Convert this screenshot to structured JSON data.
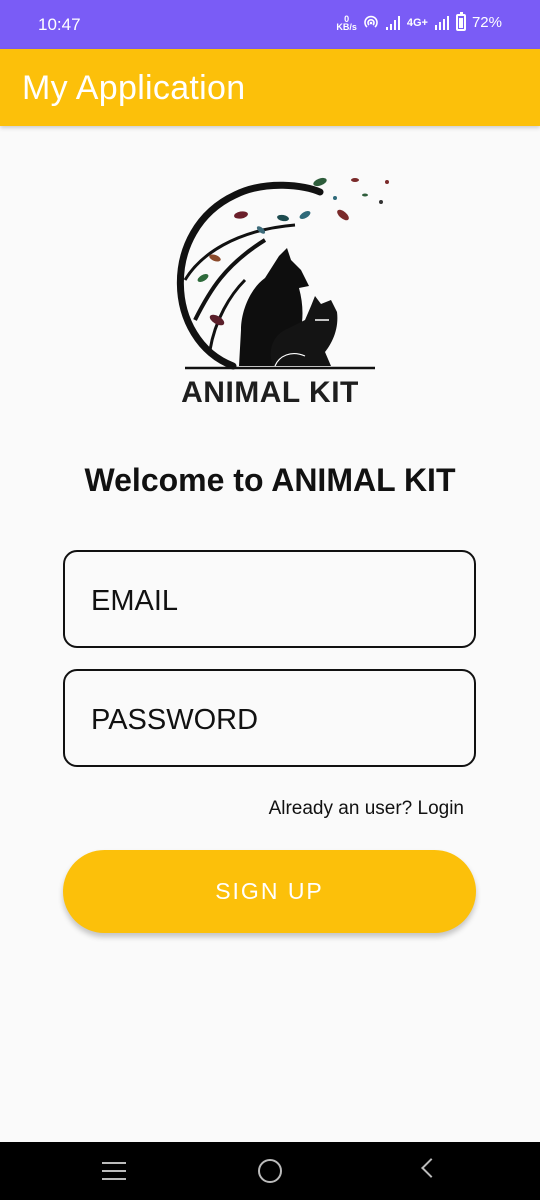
{
  "status_bar": {
    "time": "10:47",
    "net_speed_value": "0",
    "net_speed_unit": "KB/s",
    "network": "4G+",
    "battery": "72%",
    "icons": [
      "hotspot-icon",
      "signal-icon",
      "signal-icon",
      "battery-icon"
    ]
  },
  "app_bar": {
    "title": "My Application"
  },
  "logo": {
    "text": "ANIMAL KIT",
    "icon": "animal-kit-logo"
  },
  "form": {
    "welcome": "Welcome to ANIMAL KIT",
    "email_placeholder": "EMAIL",
    "email_value": "",
    "password_placeholder": "PASSWORD",
    "password_value": "",
    "login_link": "Already an user? Login",
    "signup_label": "SIGN UP"
  },
  "colors": {
    "status_bar": "#7a5cf6",
    "accent": "#fcc00a",
    "background": "#fafafa",
    "nav_bar": "#000000"
  },
  "nav_bar": {
    "icons": [
      "recent-apps-icon",
      "home-icon",
      "back-icon"
    ]
  }
}
